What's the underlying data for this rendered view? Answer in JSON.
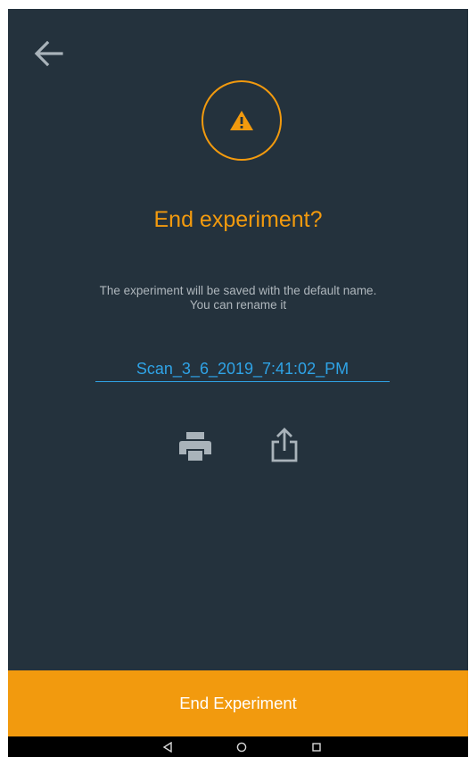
{
  "header": {
    "back_icon": "arrow-left-icon"
  },
  "dialog": {
    "warning_icon": "warning-triangle-icon",
    "title": "End experiment?",
    "message": "The experiment will be saved with the default name. You can rename it",
    "filename_value": "Scan_3_6_2019_7:41:02_PM",
    "actions": {
      "print_icon": "print-icon",
      "share_icon": "share-icon"
    }
  },
  "footer": {
    "end_button_label": "End Experiment"
  },
  "navbar": {
    "back_icon": "nav-back-icon",
    "home_icon": "nav-home-icon",
    "recents_icon": "nav-recents-icon"
  },
  "colors": {
    "background": "#24323d",
    "accent": "#f29a0e",
    "link_blue": "#2fa3e6",
    "muted_text": "#aeb6bc",
    "icon_gray": "#a9b3ba"
  }
}
